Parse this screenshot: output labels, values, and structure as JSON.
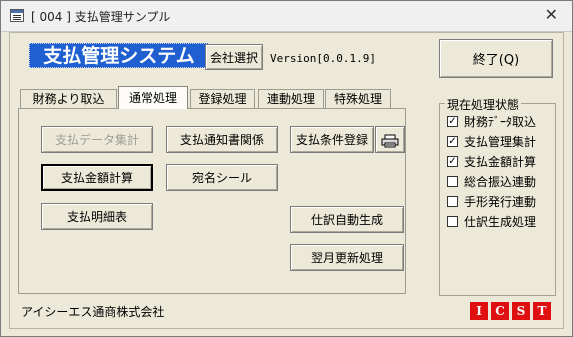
{
  "window": {
    "title": "[ 004 ] 支払管理サンプル",
    "close_label": "✕"
  },
  "header": {
    "system_title": "支払管理システム",
    "company_select_label": "会社選択",
    "version_text": "Version[0.0.1.9]",
    "exit_label": "終了(Q)"
  },
  "tabs": [
    {
      "label": "財務より取込"
    },
    {
      "label": "通常処理"
    },
    {
      "label": "登録処理"
    },
    {
      "label": "連動処理"
    },
    {
      "label": "特殊処理"
    }
  ],
  "buttons": {
    "payment_data_summary": "支払データ集計",
    "payment_notice": "支払通知書関係",
    "payment_terms_registration": "支払条件登録",
    "payment_amount_calc": "支払金額計算",
    "address_label": "宛名シール",
    "payment_statement": "支払明細表",
    "journal_auto_generate": "仕訳自動生成",
    "next_month_update": "翌月更新処理"
  },
  "status_panel": {
    "title": "現在処理状態",
    "items": [
      {
        "label": "財務ﾃﾞｰﾀ取込",
        "checked": true
      },
      {
        "label": "支払管理集計",
        "checked": true
      },
      {
        "label": "支払金額計算",
        "checked": true
      },
      {
        "label": "総合振込連動",
        "checked": false
      },
      {
        "label": "手形発行連動",
        "checked": false
      },
      {
        "label": "仕訳生成処理",
        "checked": false
      }
    ]
  },
  "footer": {
    "company_name": "アイシーエス通商株式会社",
    "logo_letters": [
      "I",
      "C",
      "S",
      "T"
    ]
  },
  "colors": {
    "title_bg": "#1f5fcf",
    "logo_red": "#e01010",
    "window_bg": "#ece9d8"
  }
}
